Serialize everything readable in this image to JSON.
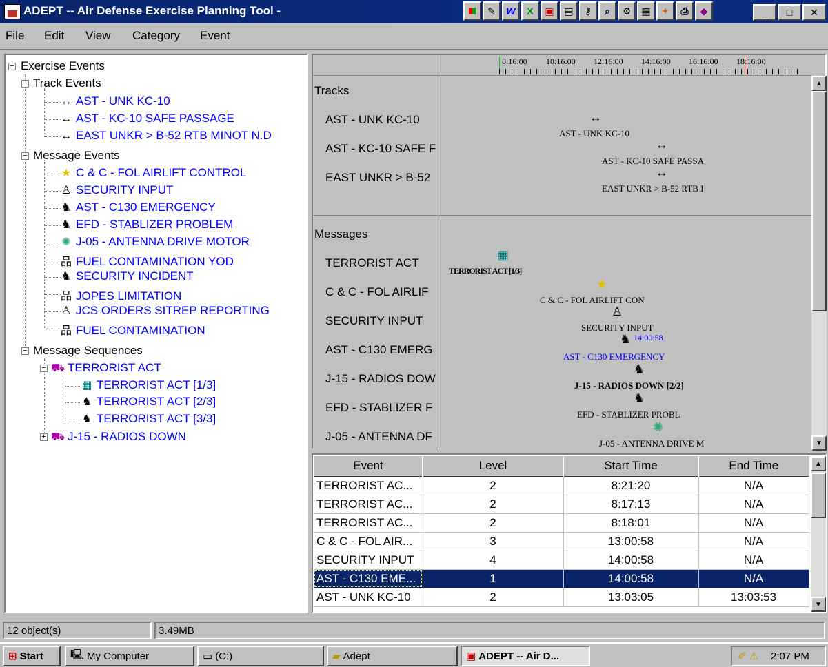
{
  "window": {
    "title": "ADEPT -- Air Defense Exercise Planning Tool -"
  },
  "menu": [
    "File",
    "Edit",
    "View",
    "Category",
    "Event"
  ],
  "tree": {
    "root": "Exercise Events",
    "track_events": {
      "label": "Track Events",
      "items": [
        "AST - UNK KC-10",
        "AST - KC-10 SAFE PASSAGE",
        "EAST UNKR > B-52 RTB MINOT N.D"
      ]
    },
    "message_events": {
      "label": "Message Events",
      "items": [
        "C & C - FOL AIRLIFT CONTROL",
        "SECURITY INPUT",
        "AST - C130 EMERGENCY",
        "EFD - STABLIZER PROBLEM",
        "J-05 - ANTENNA DRIVE MOTOR",
        "FUEL CONTAMINATION YOD",
        "SECURITY INCIDENT",
        "JOPES LIMITATION",
        "JCS ORDERS SITREP REPORTING",
        "FUEL CONTAMINATION"
      ]
    },
    "message_sequences": {
      "label": "Message Sequences",
      "terrorist": {
        "label": "TERRORIST ACT",
        "children": [
          "TERRORIST ACT [1/3]",
          "TERRORIST ACT [2/3]",
          "TERRORIST ACT [3/3]"
        ]
      },
      "radios": {
        "label": "J-15 - RADIOS DOWN"
      }
    }
  },
  "timeline": {
    "ruler": [
      "8:16:00",
      "10:16:00",
      "12:16:00",
      "14:16:00",
      "16:16:00",
      "18:16:00"
    ],
    "tracks_header": "Tracks",
    "tracks": [
      "AST - UNK KC-10",
      "AST - KC-10 SAFE F",
      "EAST UNKR > B-52"
    ],
    "messages_header": "Messages",
    "messages": [
      "TERRORIST ACT",
      "C & C - FOL AIRLIF",
      "SECURITY INPUT",
      "AST - C130 EMERG",
      "J-15 - RADIOS DOW",
      "EFD - STABLIZER F",
      "J-05 - ANTENNA DF"
    ],
    "chart_labels": {
      "unk_kc10": "AST - UNK KC-10",
      "kc10_safe": "AST - KC-10 SAFE PASSA",
      "b52": "EAST UNKR > B-52 RTB I",
      "terrorist": "TERRORIST ACT [1/3]",
      "cc": "C & C - FOL AIRLIFT CON",
      "security": "SECURITY INPUT",
      "security_time": "14:00:58",
      "c130": "AST - C130 EMERGENCY",
      "radios": "J-15 - RADIOS DOWN [2/2]",
      "efd": "EFD - STABLIZER PROBL",
      "j05": "J-05 - ANTENNA DRIVE M"
    }
  },
  "grid": {
    "headers": [
      "Event",
      "Level",
      "Start Time",
      "End Time"
    ],
    "rows": [
      [
        "TERRORIST AC...",
        "2",
        "8:21:20",
        "N/A"
      ],
      [
        "TERRORIST AC...",
        "2",
        "8:17:13",
        "N/A"
      ],
      [
        "TERRORIST AC...",
        "2",
        "8:18:01",
        "N/A"
      ],
      [
        "C & C - FOL AIR...",
        "3",
        "13:00:58",
        "N/A"
      ],
      [
        "SECURITY INPUT",
        "4",
        "14:00:58",
        "N/A"
      ],
      [
        "AST - C130 EME...",
        "1",
        "14:00:58",
        "N/A"
      ],
      [
        "AST - UNK KC-10",
        "2",
        "13:03:05",
        "13:03:53"
      ]
    ],
    "selected_row": 5
  },
  "status": {
    "objects": "12 object(s)",
    "size": "3.49MB"
  },
  "taskbar": {
    "start": "Start",
    "items": [
      "My Computer",
      "(C:)",
      "Adept",
      "ADEPT -- Air D..."
    ],
    "clock": "2:07 PM"
  }
}
